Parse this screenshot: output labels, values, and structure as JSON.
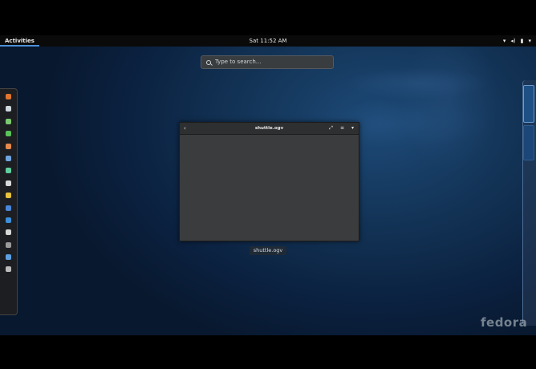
{
  "topbar": {
    "activities": "Activities",
    "clock": "Sat 11:52 AM",
    "tray_icons": [
      "wifi-icon",
      "volume-icon",
      "battery-icon",
      "chevron-down-icon"
    ]
  },
  "search": {
    "placeholder": "Type to search..."
  },
  "dash": {
    "apps": [
      {
        "icon": "firefox-icon",
        "color": "#e0752d"
      },
      {
        "icon": "chat-icon",
        "color": "#cfd7df"
      },
      {
        "icon": "messaging-icon",
        "color": "#7bc96f"
      },
      {
        "icon": "spreadsheet-icon",
        "color": "#5ac259"
      },
      {
        "icon": "presentation-icon",
        "color": "#e68a4b"
      },
      {
        "icon": "document-icon",
        "color": "#6fa5df"
      },
      {
        "icon": "browser-icon",
        "color": "#5fcf9e"
      },
      {
        "icon": "calculator-icon",
        "color": "#d9d9d9"
      },
      {
        "icon": "drawing-icon",
        "color": "#e8c23b"
      },
      {
        "icon": "download-icon",
        "color": "#4a86d8"
      },
      {
        "icon": "vscode-icon",
        "color": "#3c8fd9"
      },
      {
        "icon": "notes-icon",
        "color": "#d7d7d7"
      },
      {
        "icon": "terminal-icon",
        "color": "#9a9a9a"
      },
      {
        "icon": "tools-icon",
        "color": "#5da0e2"
      },
      {
        "icon": "show-apps-icon",
        "color": "#bbbbbb"
      }
    ]
  },
  "window": {
    "title": "shuttle.ogv",
    "caption": "shuttle.ogv",
    "back": "‹",
    "controls": [
      "⤢",
      "≡",
      "▾"
    ]
  },
  "branding": {
    "logo": "fedora"
  }
}
